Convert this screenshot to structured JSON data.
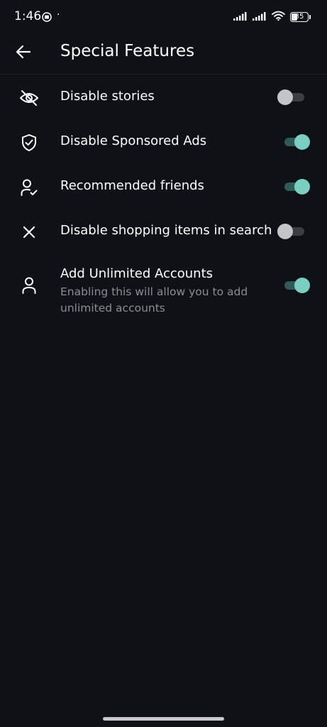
{
  "status_bar": {
    "time": "1:46",
    "dot": "·",
    "battery_level": "35",
    "icons": [
      "media-icon",
      "signal-icon",
      "signal-icon",
      "wifi-icon",
      "battery-icon"
    ]
  },
  "header": {
    "title": "Special Features",
    "back_icon": "arrow-left-icon"
  },
  "settings": [
    {
      "icon": "eye-off-icon",
      "title": "Disable stories",
      "enabled": false
    },
    {
      "icon": "shield-check-icon",
      "title": "Disable Sponsored Ads",
      "enabled": true
    },
    {
      "icon": "user-check-icon",
      "title": "Recommended friends",
      "enabled": true
    },
    {
      "icon": "close-icon",
      "title": "Disable shopping items in search",
      "enabled": false
    },
    {
      "icon": "user-icon",
      "title": "Add Unlimited Accounts",
      "description": "Enabling this will allow you to add unlimited accounts",
      "enabled": true
    }
  ],
  "colors": {
    "background": "#0e1116",
    "accent": "#7bcfc2",
    "track_on": "#2f5a55",
    "track_off": "#3a3d42",
    "knob_off": "#c4c5c8",
    "secondary_text": "#8a8e94"
  }
}
